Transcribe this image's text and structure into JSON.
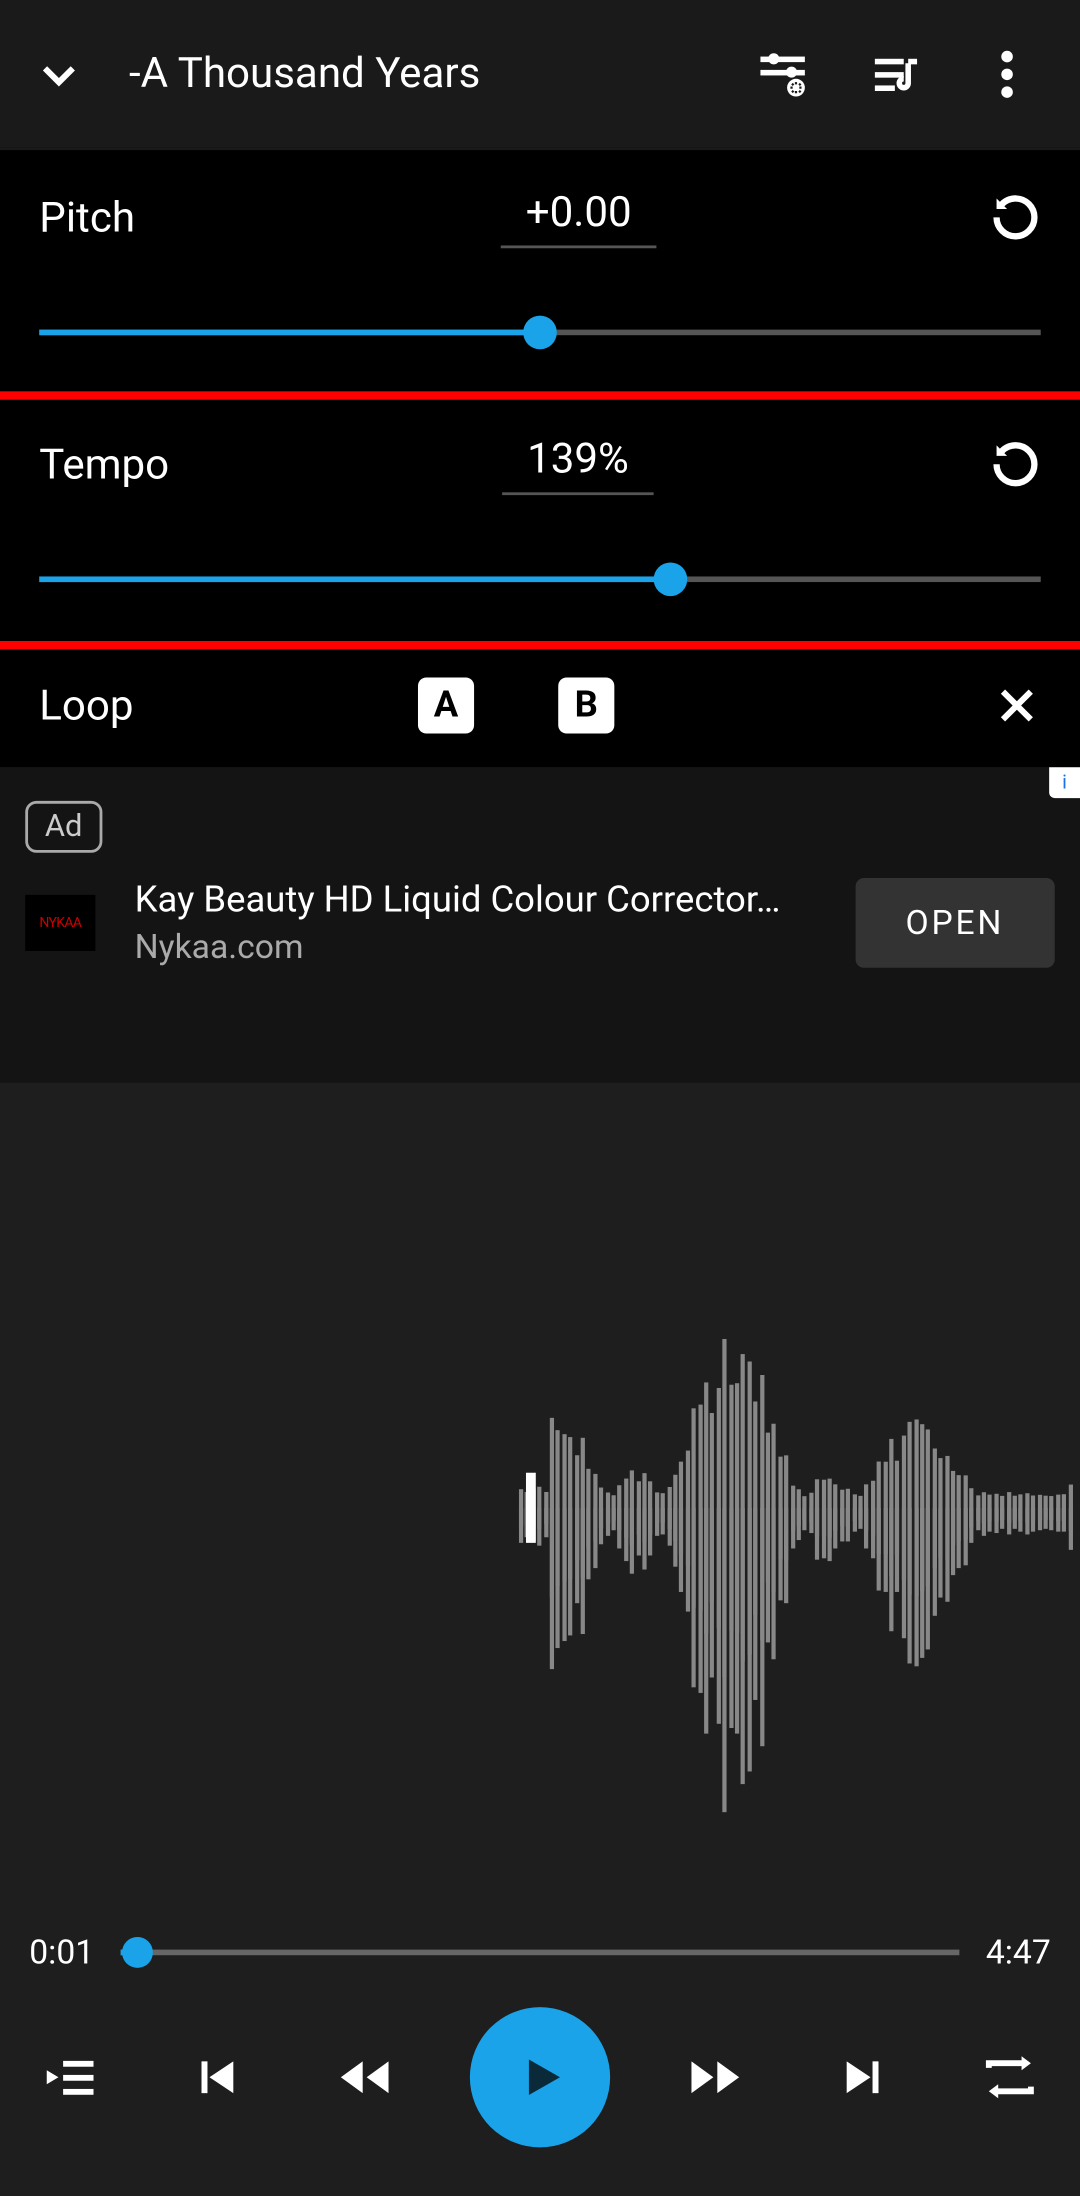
{
  "header": {
    "title": "-A Thousand Years"
  },
  "pitch": {
    "label": "Pitch",
    "value": "+0.00",
    "slider_percent": 50
  },
  "tempo": {
    "label": "Tempo",
    "value": "139%",
    "slider_percent": 63,
    "highlighted": true
  },
  "loop": {
    "label": "Loop",
    "a": "A",
    "b": "B"
  },
  "ad": {
    "badge": "Ad",
    "title": "Kay Beauty HD Liquid Colour Corrector…",
    "source": "Nykaa.com",
    "cta": "OPEN",
    "info_icon": "i"
  },
  "playback": {
    "current_time": "0:01",
    "total_time": "4:47",
    "progress_percent": 2
  },
  "colors": {
    "accent": "#1aa3e8",
    "bg": "#1a1a1a",
    "panel": "#000"
  }
}
